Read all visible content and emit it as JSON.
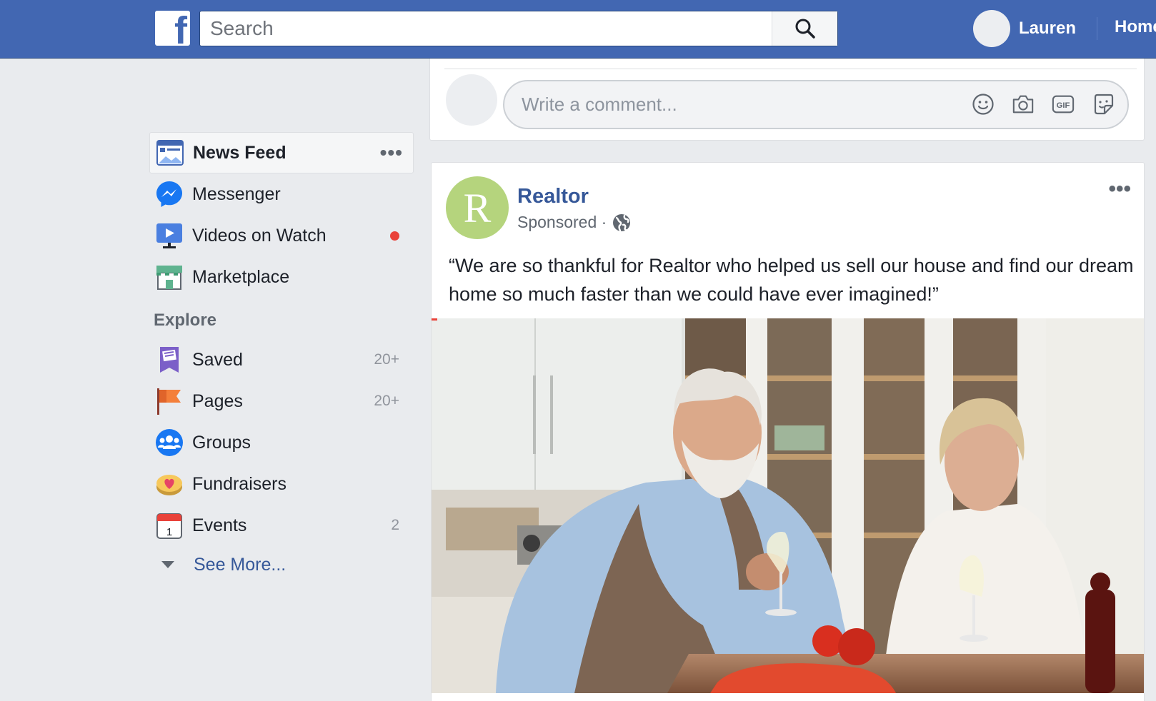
{
  "topbar": {
    "logo_letter": "f",
    "search_placeholder": "Search",
    "profile_name": "Lauren",
    "home_label": "Home"
  },
  "nav": {
    "items": [
      {
        "label": "News Feed",
        "active": true,
        "icon": "news-feed-icon",
        "dots": "•••"
      },
      {
        "label": "Messenger",
        "icon": "messenger-icon"
      },
      {
        "label": "Videos on Watch",
        "icon": "watch-icon",
        "has_dot": true
      },
      {
        "label": "Marketplace",
        "icon": "marketplace-icon"
      }
    ],
    "explore_heading": "Explore",
    "explore": [
      {
        "label": "Saved",
        "count": "20+",
        "icon": "saved-icon"
      },
      {
        "label": "Pages",
        "count": "20+",
        "icon": "pages-flag-icon"
      },
      {
        "label": "Groups",
        "count": "",
        "icon": "groups-icon"
      },
      {
        "label": "Fundraisers",
        "count": "",
        "icon": "fundraisers-icon"
      },
      {
        "label": "Events",
        "count": "2",
        "icon": "events-calendar-icon"
      }
    ],
    "see_more": "See More..."
  },
  "comment": {
    "placeholder": "Write a comment...",
    "icons": [
      "emoji-icon",
      "camera-icon",
      "gif-icon",
      "sticker-icon"
    ],
    "gif_text": "GIF"
  },
  "post": {
    "page_avatar_letter": "R",
    "page_name": "Realtor",
    "sponsored": "Sponsored ·",
    "text": "“We are so thankful for Realtor who helped us sell our house and find our dream home so much faster than we could have ever imagined!”"
  },
  "colors": {
    "brand": "#4267b2",
    "link": "#365899",
    "avatar_green": "#b5d47d",
    "notification_red": "#e9423a"
  }
}
